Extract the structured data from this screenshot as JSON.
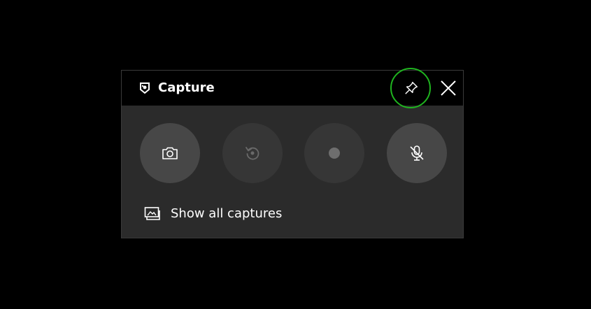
{
  "widget": {
    "title": "Capture",
    "icon": "capture-widget-icon",
    "pin_icon": "pin-icon",
    "close_icon": "close-icon",
    "accent_ring_color": "#1fb41f"
  },
  "buttons": [
    {
      "name": "screenshot",
      "icon": "camera-icon",
      "state": "enabled"
    },
    {
      "name": "record-last-30s",
      "icon": "replay-icon",
      "state": "disabled"
    },
    {
      "name": "start-recording",
      "icon": "record-dot-icon",
      "state": "disabled"
    },
    {
      "name": "mic-toggle",
      "icon": "mic-off-icon",
      "state": "enabled"
    }
  ],
  "footer": {
    "show_all_label": "Show all captures",
    "icon": "gallery-icon"
  }
}
